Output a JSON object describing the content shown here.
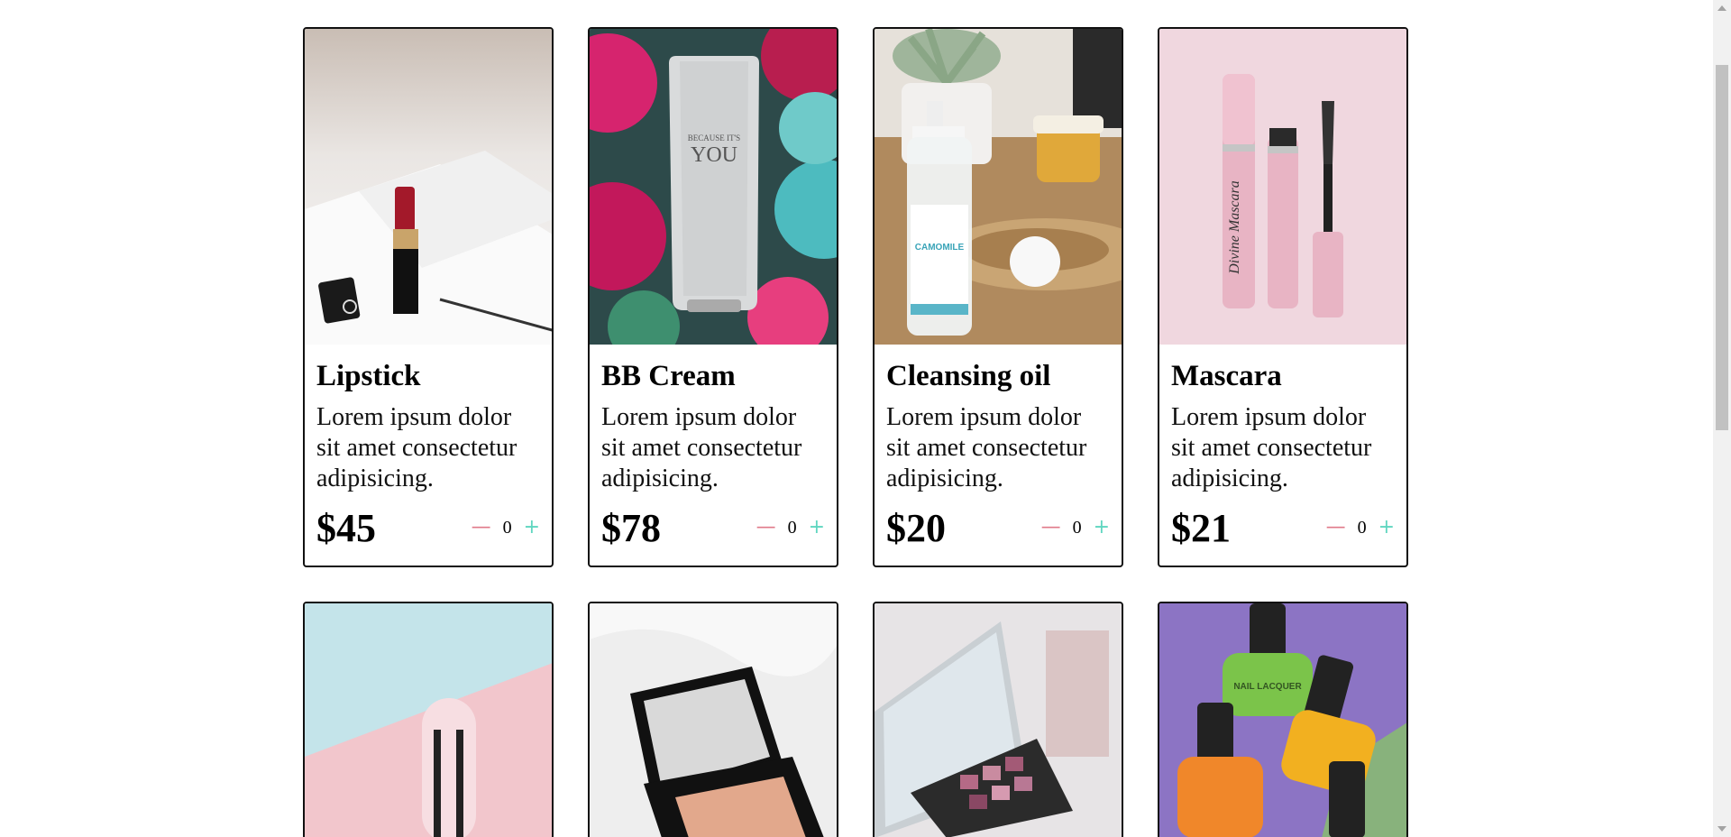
{
  "products": [
    {
      "title": "Lipstick",
      "description": "Lorem ipsum dolor sit amet consectetur adipisicing.",
      "price": "$45",
      "quantity": "0",
      "image_icon": "lipstick-photo"
    },
    {
      "title": "BB Cream",
      "description": "Lorem ipsum dolor sit amet consectetur adipisicing.",
      "price": "$78",
      "quantity": "0",
      "image_icon": "bb-cream-tube-photo",
      "image_text": "BECAUSE IT'S YOU"
    },
    {
      "title": "Cleansing oil",
      "description": "Lorem ipsum dolor sit amet consectetur adipisicing.",
      "price": "$20",
      "quantity": "0",
      "image_icon": "cleansing-oil-bottle-photo",
      "image_text": "CAMOMILE"
    },
    {
      "title": "Mascara",
      "description": "Lorem ipsum dolor sit amet consectetur adipisicing.",
      "price": "$21",
      "quantity": "0",
      "image_icon": "mascara-photo",
      "image_text": "Divine Mascara"
    }
  ],
  "lower_products": [
    {
      "image_icon": "pink-blue-cosmetic-photo"
    },
    {
      "image_icon": "compact-powder-photo"
    },
    {
      "image_icon": "eyeshadow-palette-photo"
    },
    {
      "image_icon": "nail-lacquer-photo",
      "image_text": "NAIL LACQUER"
    }
  ],
  "controls": {
    "minus_symbol": "—",
    "plus_symbol": "+"
  },
  "colors": {
    "minus": "#e07a8a",
    "plus": "#5fd6c0",
    "card_border": "#111111"
  }
}
